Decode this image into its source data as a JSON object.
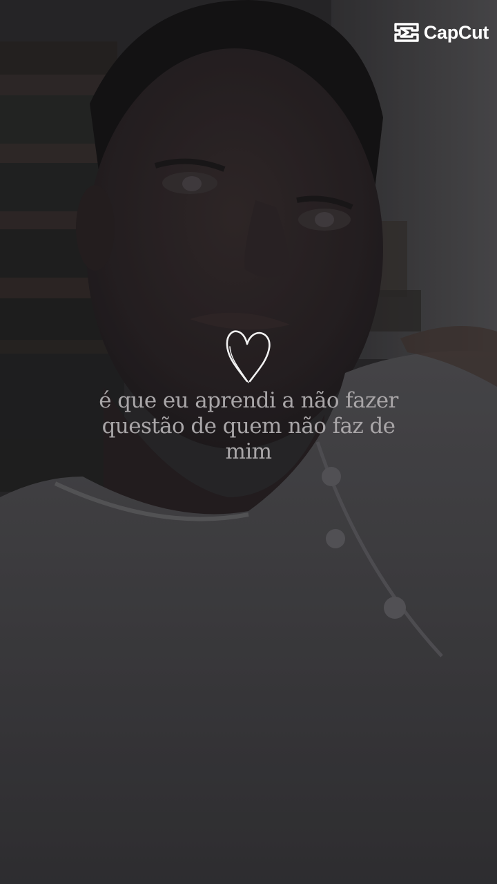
{
  "video": {
    "caption_lines": [
      "é que eu aprendi a não fazer",
      "questão de quem não faz de",
      "mim"
    ],
    "sticker_icon": "heart-outline-icon"
  },
  "watermark": {
    "text": "CapCut",
    "icon": "capcut-logo-icon"
  },
  "colors": {
    "caption": "#a9a6a8",
    "watermark": "#ffffff",
    "heart": "#f2f2f2"
  }
}
